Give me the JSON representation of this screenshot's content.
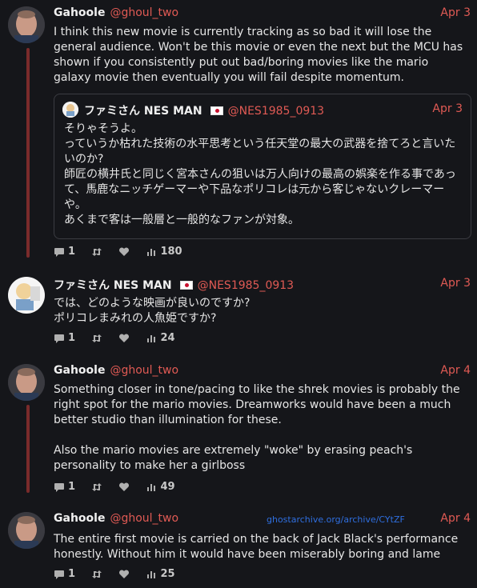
{
  "tweets": [
    {
      "name": "Gahoole",
      "handle": "@ghoul_two",
      "date": "Apr 3",
      "text": "I think this new movie is currently tracking as so bad it will lose the general audience. Won't be this movie or even the next but the MCU has shown if you consistently put out bad/boring movies like the mario galaxy movie then eventually you will fail despite momentum.",
      "quote": {
        "name": "ファミさん NES MAN",
        "handle": "@NES1985_0913",
        "date": "Apr 3",
        "text": "そりゃそうよ。\nっていうか枯れた技術の水平思考という任天堂の最大の武器を捨てろと言いたいのか?\n師匠の横井氏と同じく宮本さんの狙いは万人向けの最高の娯楽を作る事であって、馬鹿なニッチゲーマーや下品なポリコレは元から客じゃないクレーマーや。\nあくまで客は一般層と一般的なファンが対象。"
      },
      "replies": "1",
      "views": "180"
    },
    {
      "name": "ファミさん NES MAN",
      "handle": "@NES1985_0913",
      "date": "Apr 3",
      "text": "では、どのような映画が良いのですか?\nポリコレまみれの人魚姫ですか?",
      "replies": "1",
      "views": "24"
    },
    {
      "name": "Gahoole",
      "handle": "@ghoul_two",
      "date": "Apr 4",
      "text": "Something closer in tone/pacing to like the shrek movies is probably the right spot for the mario movies. Dreamworks would have been a much better studio than illumination for these.\n\nAlso the mario movies are extremely \"woke\" by erasing peach's personality to make her a girlboss",
      "replies": "1",
      "views": "49"
    },
    {
      "name": "Gahoole",
      "handle": "@ghoul_two",
      "date": "Apr 4",
      "text": "The entire first movie is carried on the back of Jack Black's performance honestly. Without him it would have been miserably boring and lame",
      "replies": "1",
      "views": "25"
    }
  ],
  "watermark": "ghostarchive.org/archive/CYtZF",
  "colors": {
    "accent": "#e05a54",
    "background": "#15161a",
    "thread": "#7a2b2b"
  }
}
